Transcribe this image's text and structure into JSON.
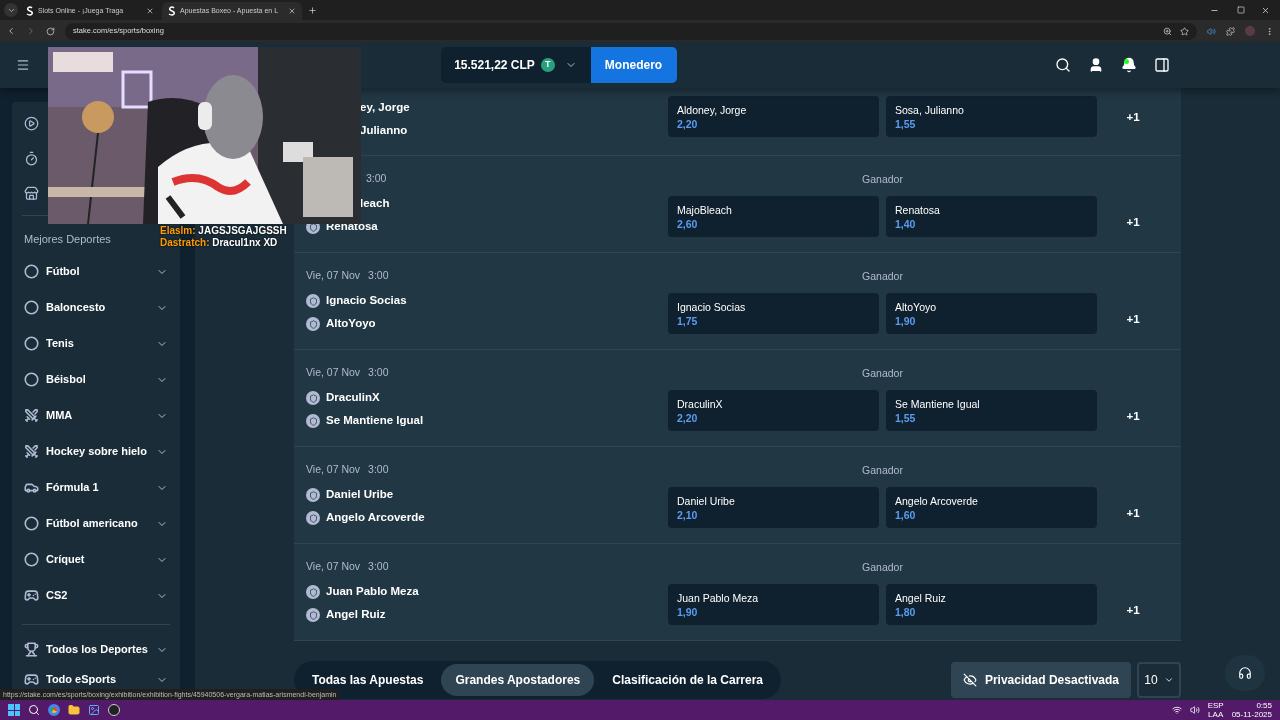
{
  "browser": {
    "tabs": [
      {
        "title": "Slots Online - ¡Juega Traga",
        "selected": false
      },
      {
        "title": "Apuestas Boxeo - Apuesta en L",
        "selected": true
      }
    ],
    "url": "stake.com/es/sports/boxing"
  },
  "header": {
    "balance": "15.521,22 CLP",
    "coin": "T",
    "wallet_button": "Monedero"
  },
  "sidebar": {
    "heading": "Mejores Deportes",
    "sports": [
      {
        "label": "Fútbol",
        "kind": "soccer"
      },
      {
        "label": "Baloncesto",
        "kind": "basketball"
      },
      {
        "label": "Tenis",
        "kind": "tennis"
      },
      {
        "label": "Béisbol",
        "kind": "baseball"
      },
      {
        "label": "MMA",
        "kind": "mma"
      },
      {
        "label": "Hockey sobre hielo",
        "kind": "hockey"
      },
      {
        "label": "Fórmula 1",
        "kind": "f1"
      },
      {
        "label": "Fútbol americano",
        "kind": "football"
      },
      {
        "label": "Críquet",
        "kind": "cricket"
      },
      {
        "label": "CS2",
        "kind": "cs2"
      }
    ],
    "more": [
      {
        "label": "Todos los Deportes",
        "kind": "all"
      },
      {
        "label": "Todo eSports",
        "kind": "esports"
      }
    ]
  },
  "chat": [
    {
      "user": "Elaslm:",
      "message": "JAGSJSGAJGSSH"
    },
    {
      "user": "Dastratch:",
      "message": "Dracul1nx XD"
    }
  ],
  "matches": [
    {
      "teams": [
        {
          "name": "ey, Jorge",
          "partial": true
        },
        {
          "name": "Julianno",
          "partial": true
        }
      ],
      "odds": [
        {
          "name": "Aldoney, Jorge",
          "price": "2,20"
        },
        {
          "name": "Sosa, Julianno",
          "price": "1,55"
        }
      ],
      "more": "+1"
    },
    {
      "time": "3:00",
      "market": "Ganador",
      "teams": [
        {
          "name": "leach",
          "partial": true
        },
        {
          "name": "Renatosa",
          "partial": false
        }
      ],
      "odds": [
        {
          "name": "MajoBleach",
          "price": "2,60"
        },
        {
          "name": "Renatosa",
          "price": "1,40"
        }
      ],
      "more": "+1"
    },
    {
      "day": "Vie, 07 Nov",
      "time": "3:00",
      "market": "Ganador",
      "teams": [
        {
          "name": "Ignacio Socias",
          "partial": false
        },
        {
          "name": "AltoYoyo",
          "partial": false
        }
      ],
      "odds": [
        {
          "name": "Ignacio Socias",
          "price": "1,75"
        },
        {
          "name": "AltoYoyo",
          "price": "1,90"
        }
      ],
      "more": "+1"
    },
    {
      "day": "Vie, 07 Nov",
      "time": "3:00",
      "market": "Ganador",
      "teams": [
        {
          "name": "DraculinX",
          "partial": false
        },
        {
          "name": "Se Mantiene Igual",
          "partial": false
        }
      ],
      "odds": [
        {
          "name": "DraculinX",
          "price": "2,20"
        },
        {
          "name": "Se Mantiene Igual",
          "price": "1,55"
        }
      ],
      "more": "+1"
    },
    {
      "day": "Vie, 07 Nov",
      "time": "3:00",
      "market": "Ganador",
      "teams": [
        {
          "name": "Daniel Uribe",
          "partial": false
        },
        {
          "name": "Angelo Arcoverde",
          "partial": false
        }
      ],
      "odds": [
        {
          "name": "Daniel Uribe",
          "price": "2,10"
        },
        {
          "name": "Angelo Arcoverde",
          "price": "1,60"
        }
      ],
      "more": "+1"
    },
    {
      "day": "Vie, 07 Nov",
      "time": "3:00",
      "market": "Ganador",
      "teams": [
        {
          "name": "Juan Pablo Meza",
          "partial": false
        },
        {
          "name": "Angel Ruiz",
          "partial": false
        }
      ],
      "odds": [
        {
          "name": "Juan Pablo Meza",
          "price": "1,90"
        },
        {
          "name": "Angel Ruiz",
          "price": "1,80"
        }
      ],
      "more": "+1"
    }
  ],
  "bets_tabs": [
    {
      "label": "Todas las Apuestas",
      "selected": false
    },
    {
      "label": "Grandes Apostadores",
      "selected": true
    },
    {
      "label": "Clasificación de la Carrera",
      "selected": false
    }
  ],
  "privacy_button": "Privacidad Desactivada",
  "page_size": "10",
  "status_url": "https://stake.com/es/sports/boxing/exhibition/exhibition-fights/45940506-vergara-matias-arismendi-benjamin",
  "taskbar": {
    "language": "ESP",
    "layout": "LAA",
    "time": "0:55",
    "date": "05-11-2025"
  }
}
